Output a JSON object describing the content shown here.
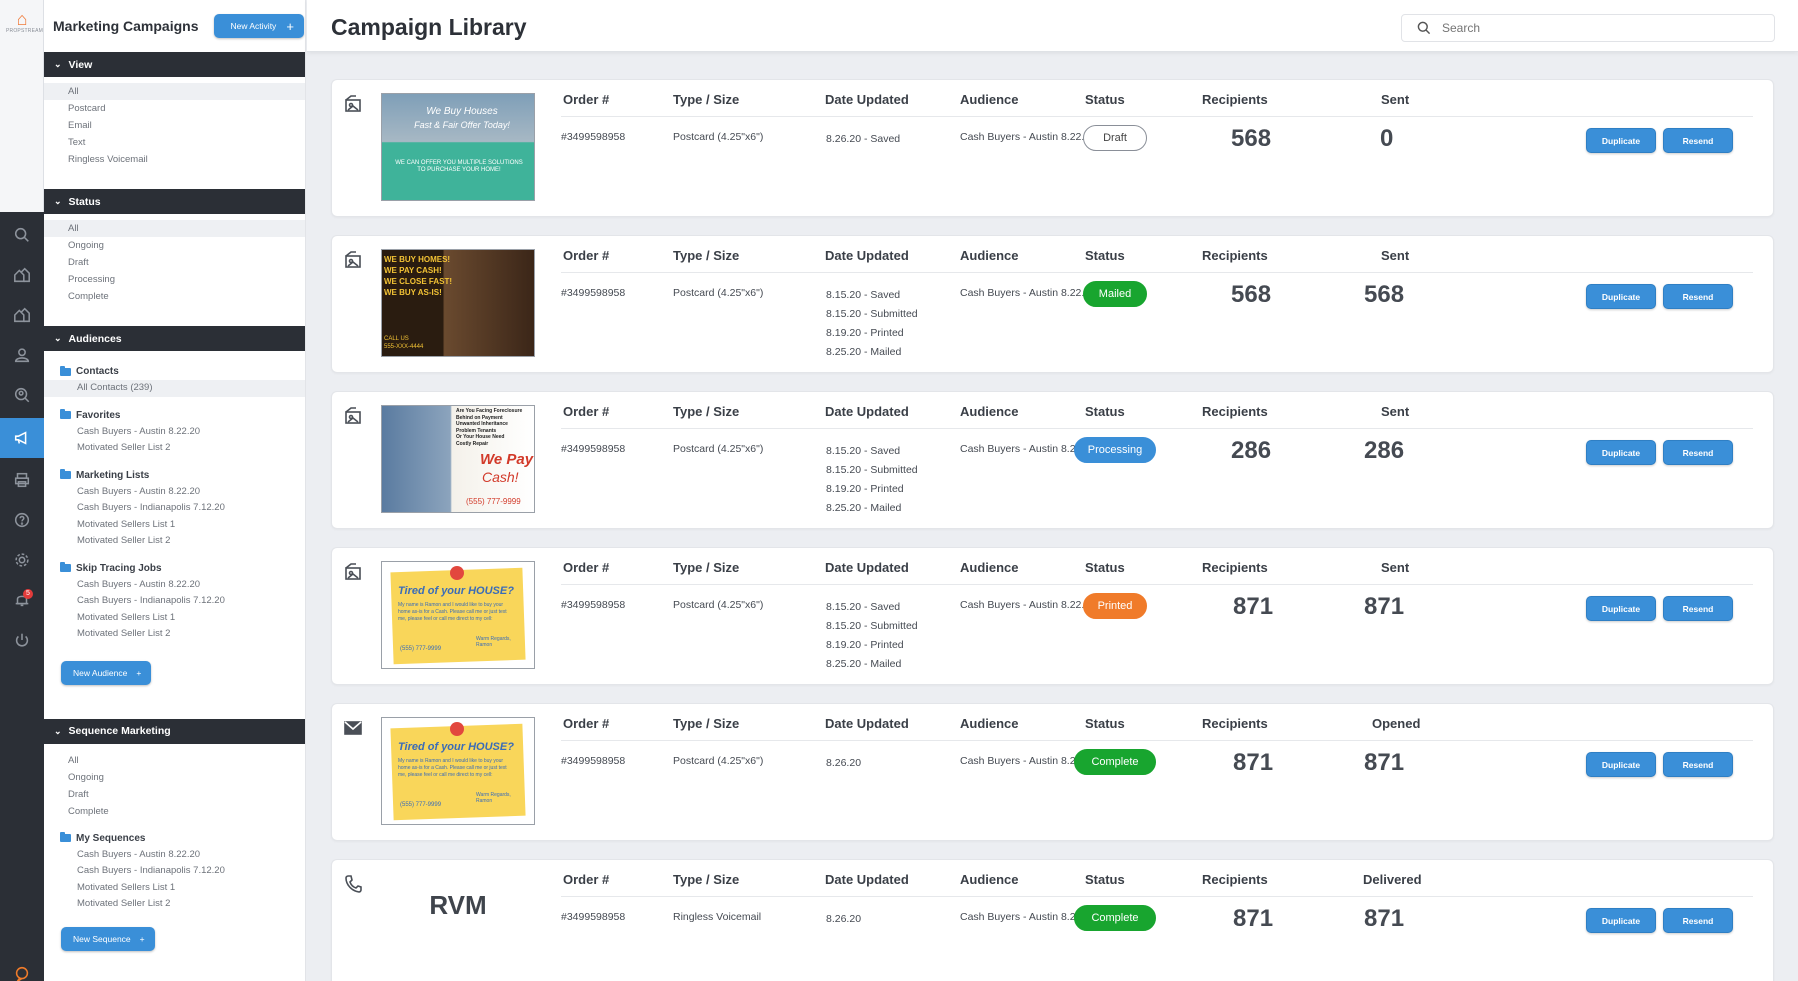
{
  "app": {
    "logo_word": "PROPSTREAM",
    "section_title": "Marketing Campaigns",
    "new_activity": "New Activity",
    "page_title": "Campaign Library",
    "search_placeholder": "Search",
    "notification_count": "5"
  },
  "sidebar": {
    "view": {
      "title": "View",
      "items": [
        "All",
        "Postcard",
        "Email",
        "Text",
        "Ringless Voicemail"
      ]
    },
    "status": {
      "title": "Status",
      "items": [
        "All",
        "Ongoing",
        "Draft",
        "Processing",
        "Complete"
      ]
    },
    "audiences": {
      "title": "Audiences",
      "groups": [
        {
          "name": "Contacts",
          "items": [
            "All Contacts (239)"
          ]
        },
        {
          "name": "Favorites",
          "items": [
            "Cash Buyers - Austin 8.22.20",
            "Motivated Seller List 2"
          ]
        },
        {
          "name": "Marketing Lists",
          "items": [
            "Cash Buyers - Austin 8.22.20",
            "Cash Buyers - Indianapolis 7.12.20",
            "Motivated Sellers List 1",
            "Motivated Seller List 2"
          ]
        },
        {
          "name": "Skip Tracing Jobs",
          "items": [
            "Cash Buyers - Austin 8.22.20",
            "Cash Buyers - Indianapolis 7.12.20",
            "Motivated Sellers List 1",
            "Motivated Seller List 2"
          ]
        }
      ],
      "new_button": "New Audience"
    },
    "sequence": {
      "title": "Sequence Marketing",
      "items": [
        "All",
        "Ongoing",
        "Draft",
        "Complete"
      ],
      "group": {
        "name": "My Sequences",
        "items": [
          "Cash Buyers - Austin 8.22.20",
          "Cash Buyers - Indianapolis 7.12.20",
          "Motivated Sellers List 1",
          "Motivated Seller List 2"
        ]
      },
      "new_button": "New Sequence"
    }
  },
  "columns": {
    "order": "Order #",
    "type": "Type / Size",
    "date": "Date Updated",
    "audience": "Audience",
    "status": "Status",
    "recipients": "Recipients"
  },
  "actions": {
    "duplicate": "Duplicate",
    "resend": "Resend"
  },
  "status_colors": {
    "Mailed": "#18a52f",
    "Processing": "#3a8fd8",
    "Printed": "#f07b2a",
    "Complete": "#18a52f"
  },
  "campaigns": [
    {
      "kind": "postcard",
      "thumb_lines": [
        "We Buy Houses",
        "Fast & Fair Offer Today!",
        "WE CAN OFFER YOU MULTIPLE SOLUTIONS TO PURCHASE YOUR HOME!"
      ],
      "order": "#3499598958",
      "type": "Postcard (4.25\"x6\")",
      "dates": [
        "8.26.20 - Saved"
      ],
      "audience": "Cash Buyers - Austin 8.22.20",
      "status": "Draft",
      "recipients": "568",
      "last_label": "Sent",
      "last_value": "0"
    },
    {
      "kind": "postcard",
      "thumb_lines": [
        "WE BUY HOMES!",
        "WE PAY CASH!",
        "WE CLOSE FAST!",
        "WE BUY AS-IS!",
        "CALL US",
        "555-XXX-4444"
      ],
      "order": "#3499598958",
      "type": "Postcard (4.25\"x6\")",
      "dates": [
        "8.15.20 - Saved",
        "8.15.20 - Submitted",
        "8.19.20 - Printed",
        "8.25.20 - Mailed"
      ],
      "audience": "Cash Buyers - Austin 8.22.20",
      "status": "Mailed",
      "recipients": "568",
      "last_label": "Sent",
      "last_value": "568"
    },
    {
      "kind": "postcard",
      "thumb_lines": [
        "Are You Facing Foreclosure",
        "Behind on Payment",
        "Unwanted Inheritance",
        "Problem Tenants",
        "Or Your House Need",
        "Costly Repair",
        "We Pay",
        "Cash!",
        "(555) 777-9999"
      ],
      "order": "#3499598958",
      "type": "Postcard (4.25\"x6\")",
      "dates": [
        "8.15.20 - Saved",
        "8.15.20 - Submitted",
        "8.19.20 - Printed",
        "8.25.20 - Mailed"
      ],
      "audience": "Cash Buyers - Austin 8.22.20",
      "status": "Processing",
      "recipients": "286",
      "last_label": "Sent",
      "last_value": "286"
    },
    {
      "kind": "postcard",
      "thumb_lines": [
        "Tired of your HOUSE?",
        "My name is Ramon and I would like to buy your home as-is for a Cash. Please call me or just text me, please feel or call me direct to my cell:",
        "(555) 777-9999",
        "Warm Regards, Ramon"
      ],
      "order": "#3499598958",
      "type": "Postcard (4.25\"x6\")",
      "dates": [
        "8.15.20 - Saved",
        "8.15.20 - Submitted",
        "8.19.20 - Printed",
        "8.25.20 - Mailed"
      ],
      "audience": "Cash Buyers - Austin 8.22.20",
      "status": "Printed",
      "recipients": "871",
      "last_label": "Sent",
      "last_value": "871"
    },
    {
      "kind": "email",
      "thumb_lines": [
        "Tired of your HOUSE?",
        "My name is Ramon and I would like to buy your home as-is for a Cash. Please call me or just text me, please feel or call me direct to my cell:",
        "(555) 777-9999",
        "Warm Regards, Ramon"
      ],
      "order": "#3499598958",
      "type": "Postcard (4.25\"x6\")",
      "dates": [
        "8.26.20"
      ],
      "audience": "Cash Buyers - Austin 8.22.20",
      "status": "Complete",
      "recipients": "871",
      "last_label": "Opened",
      "last_value": "871"
    },
    {
      "kind": "rvm",
      "rvm_label": "RVM",
      "order": "#3499598958",
      "type": "Ringless Voicemail",
      "dates": [
        "8.26.20"
      ],
      "audience": "Cash Buyers - Austin 8.22.20",
      "status": "Complete",
      "recipients": "871",
      "last_label": "Delivered",
      "last_value": "871"
    }
  ]
}
